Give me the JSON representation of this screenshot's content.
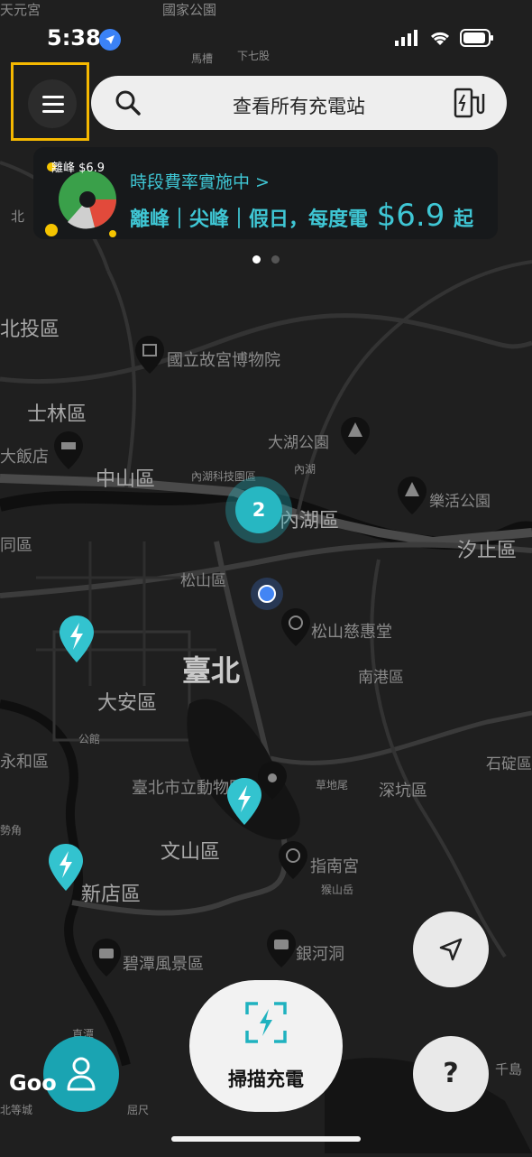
{
  "status_bar": {
    "time": "5:38"
  },
  "search": {
    "placeholder_text": "查看所有充電站"
  },
  "promo": {
    "art_text": "離峰 $6.9",
    "line1": "時段費率實施中 >",
    "line2_prefix": "離峰｜尖峰｜假日，每度電 ",
    "price": "$6.9",
    "line2_suffix": " 起"
  },
  "carousel": {
    "page_count": 2,
    "active_index": 0
  },
  "cluster": {
    "count": "2"
  },
  "scan": {
    "label": "掃描充電"
  },
  "help": {
    "label": "?"
  },
  "attribution": {
    "google": "Goo"
  },
  "map_labels": {
    "tianyuan_temple": "天元宮",
    "national_park": "國家公園",
    "matsao": "馬槽",
    "xiaqiku": "下七股",
    "beitou": "北投區",
    "palace_museum": "國立故宮博物院",
    "shilin": "士林區",
    "dahu_park": "大湖公園",
    "grand_hotel": "大飯店",
    "zhongshan": "中山區",
    "neihu_tech": "內湖科技園區",
    "neihu_small": "內湖",
    "neihu": "內湖區",
    "lehuo_park": "樂活公園",
    "datong": "同區",
    "xizhi": "汐止區",
    "songshan": "松山區",
    "ciyou_temple": "松山慈惠堂",
    "taipei": "臺北",
    "daan": "大安區",
    "nangang": "南港區",
    "gongguan": "公館",
    "yonghe": "永和區",
    "zoo": "臺北市立動物園",
    "caodiwei": "草地尾",
    "shenkeng": "深坑區",
    "shiding": "石碇區",
    "wenshan": "文山區",
    "zhinan_temple": "指南宮",
    "houshanyue": "猴山岳",
    "xindian": "新店區",
    "shijiao": "勢角",
    "bitan": "碧潭風景區",
    "yinhe_cave": "銀河洞",
    "zhiping": "直潭",
    "qiandao": "千島",
    "beicheng": "北等城",
    "quchi": "屈尺",
    "north_edge": "北"
  },
  "colors": {
    "accent": "#27b7c2",
    "highlight_border": "#f5b800",
    "map_bg": "#1f1f1f"
  }
}
